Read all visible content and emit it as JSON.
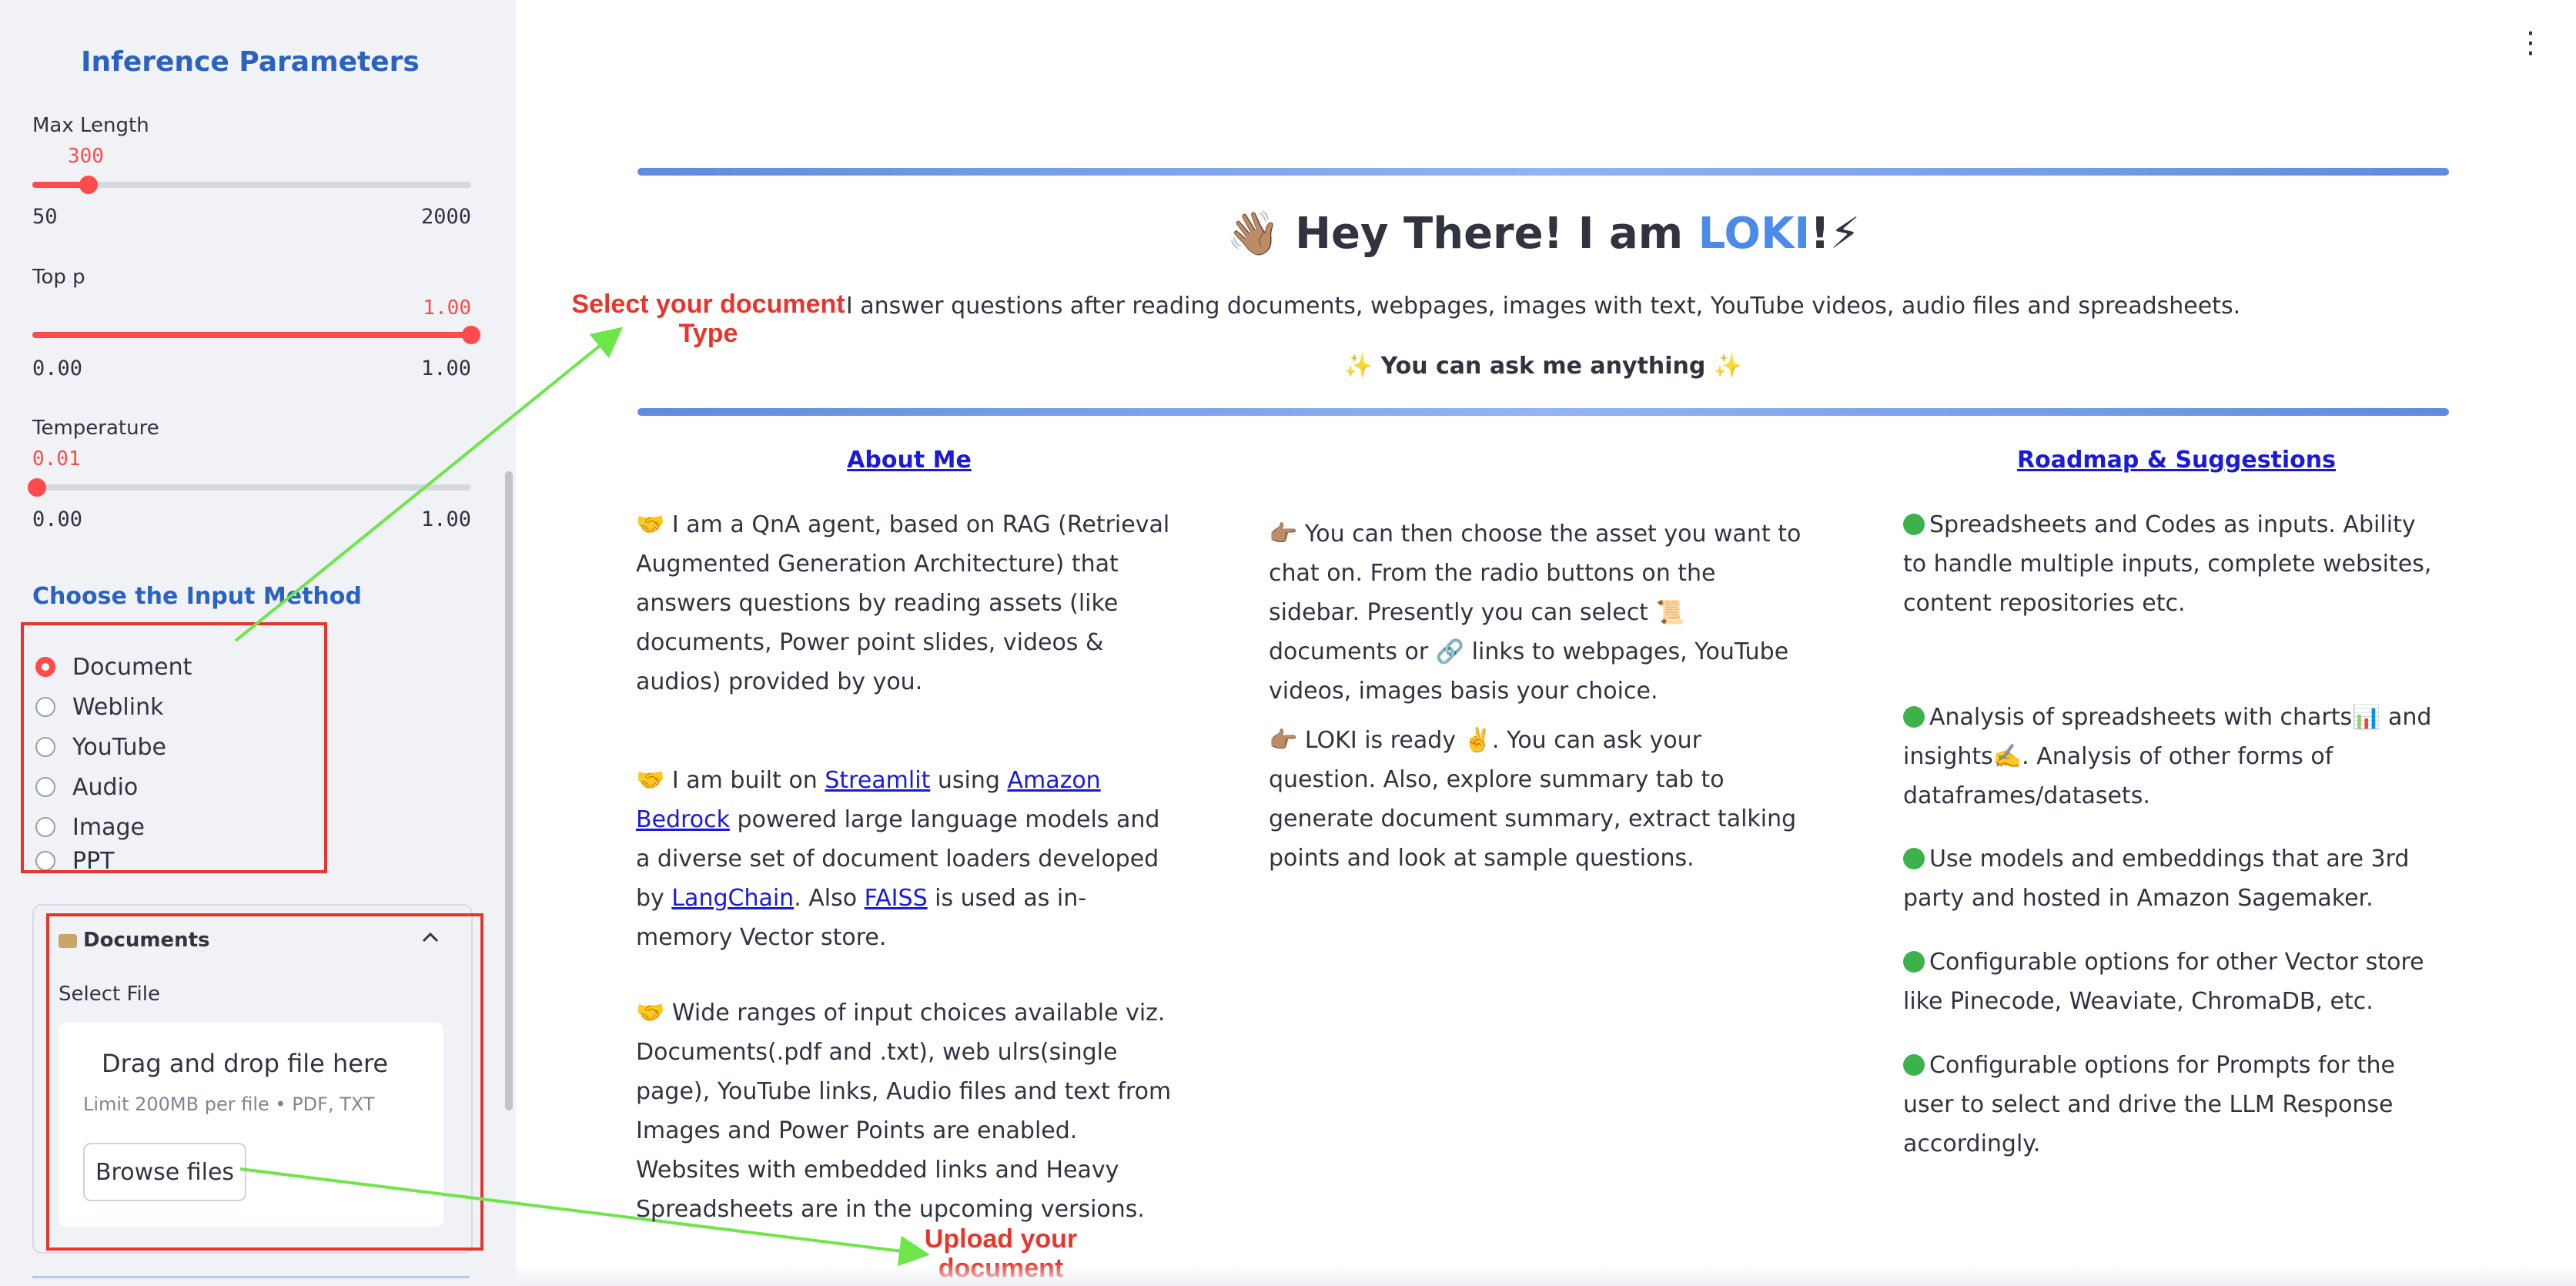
{
  "sidebar": {
    "title": "Inference Parameters",
    "sliders": [
      {
        "label": "Max Length",
        "value": "300",
        "min": "50",
        "max": "2000",
        "fraction": 0.128
      },
      {
        "label": "Top p",
        "value": "1.00",
        "min": "0.00",
        "max": "1.00",
        "fraction": 1.0
      },
      {
        "label": "Temperature",
        "value": "0.01",
        "min": "0.00",
        "max": "1.00",
        "fraction": 0.01
      }
    ],
    "input_method_heading": "Choose the Input Method",
    "input_methods": [
      {
        "label": "Document",
        "selected": true
      },
      {
        "label": "Weblink",
        "selected": false
      },
      {
        "label": "YouTube",
        "selected": false
      },
      {
        "label": "Audio",
        "selected": false
      },
      {
        "label": "Image",
        "selected": false
      },
      {
        "label": "PPT",
        "selected": false
      }
    ],
    "documents_expander": {
      "title": "Documents",
      "icon": "folder-icon",
      "select_label": "Select File",
      "dropzone_title": "Drag and drop file here",
      "dropzone_limit": "Limit 200MB per file • PDF, TXT",
      "browse_label": "Browse files"
    }
  },
  "annotations": {
    "select_type": [
      "Select your document",
      "Type"
    ],
    "upload": [
      "Upload your",
      "document"
    ],
    "box_color": "#e8352c",
    "arrow_color": "#6ee64a"
  },
  "main": {
    "hero": {
      "title_prefix": "👋🏽 Hey There! I am ",
      "title_name": "LOKI",
      "title_suffix": "!⚡",
      "subtitle": "I answer questions after reading documents, webpages, images with text, YouTube videos, audio files and spreadsheets.",
      "ask": "✨ You can ask me anything ✨"
    },
    "about_heading": "About Me",
    "roadmap_heading": "Roadmap & Suggestions",
    "about": {
      "p1": "🤝 I am a QnA agent, based on RAG (Retrieval Augmented Generation Architecture) that answers questions by reading assets (like documents, Power point slides, videos & audios) provided by you.",
      "p2_a": "🤝 I am built on ",
      "p2_link1": "Streamlit",
      "p2_b": " using ",
      "p2_link2": "Amazon Bedrock",
      "p2_c": " powered large language models and a diverse set of document loaders developed by ",
      "p2_link3": "LangChain",
      "p2_d": ". Also ",
      "p2_link4": "FAISS",
      "p2_e": " is used as in-memory Vector store.",
      "p3": "🤝 Wide ranges of input choices available viz. Documents(.pdf and .txt), web ulrs(single page), YouTube links, Audio files and text from Images and Power Points are enabled. Websites with embedded links and Heavy Spreadsheets are in the upcoming versions."
    },
    "middle": {
      "p1": "👉🏽 You can then choose the asset you want to chat on. From the radio buttons on the sidebar. Presently you can select 📜 documents or 🔗 links to webpages, YouTube videos, images basis your choice.",
      "p2": "👉🏽 LOKI is ready ✌️. You can ask your question. Also, explore summary tab to generate document summary, extract talking points and look at sample questions."
    },
    "roadmap": [
      "Spreadsheets and Codes as inputs. Ability to handle multiple inputs, complete websites, content repositories etc.",
      "Analysis of spreadsheets with charts📊 and insights✍️. Analysis of other forms of dataframes/datasets.",
      "Use models and embeddings that are 3rd party and hosted in Amazon Sagemaker.",
      "Configurable options for other Vector store like Pinecode, Weaviate, ChromaDB, etc.",
      "Configurable options for Prompts for the user to select and drive the LLM Response accordingly."
    ]
  }
}
